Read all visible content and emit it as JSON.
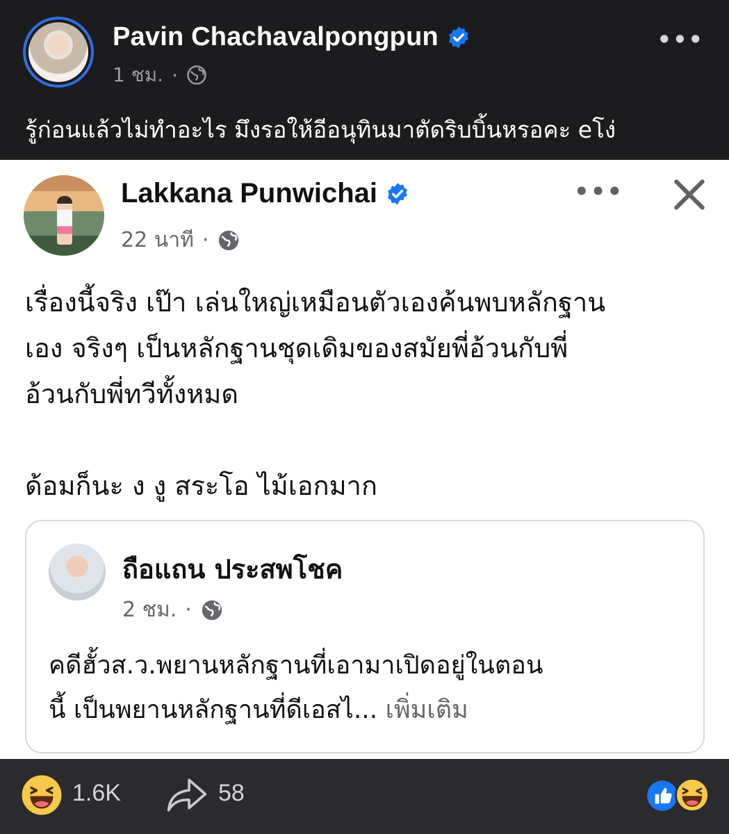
{
  "post": {
    "author": "Pavin Chachavalpongpun",
    "time": "1 ชม.",
    "separator": "·",
    "more": "•••",
    "caption": "รู้ก่อนแล้วไม่ทำอะไร มึงรอให้อีอนุทินมาตัดริบบิ้นหรอคะ eโง่"
  },
  "shared_screenshot": {
    "author": "Lakkana Punwichai",
    "time": "22 นาที",
    "separator": "·",
    "more": "•••",
    "body_lines": [
      "เรื่องนี้จริง เป๊า เล่นใหญ่เหมือนตัวเองค้นพบหลักฐาน",
      "เอง จริงๆ เป็นหลักฐานชุดเดิมของสมัยพี่อ้วนกับพี่",
      "อ้วนกับพี่ทวีทั้งหมด"
    ],
    "body_line_last": "ด้อมก็นะ ง งู สระโอ ไม้เอกมาก",
    "shared_card": {
      "author": "ถือแถน ประสพโชค",
      "time": "2 ชม.",
      "separator": "·",
      "text_line1": "คดีฮั้วส.ว.พยานหลักฐานที่เอามาเปิดอยู่ในตอน",
      "text_line2": "นี้ เป็นพยานหลักฐานที่ดีเอสไ...",
      "see_more": "เพิ่มเติม"
    }
  },
  "footer": {
    "reaction_count": "1.6K",
    "share_count": "58"
  },
  "colors": {
    "dark_bg": "#1c1c1e",
    "footer_bg": "#2b2b2e",
    "verified_blue": "#1877f2",
    "avatar_ring": "#2f6fe4",
    "meta_gray": "#65676b"
  }
}
